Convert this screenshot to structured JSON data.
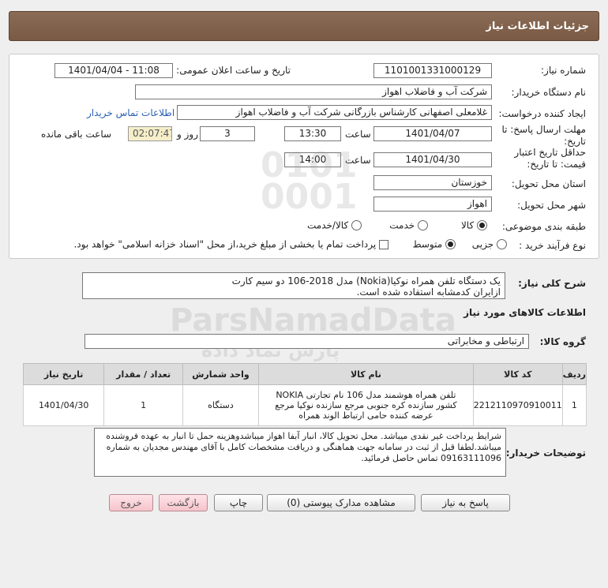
{
  "header": {
    "title": "جزئيات اطلاعات نياز"
  },
  "form": {
    "need_number_label": "شماره نیاز:",
    "need_number": "1101001331000129",
    "announce_label": "تاریخ و ساعت اعلان عمومی:",
    "announce_value": "1401/04/04 - 11:08",
    "buyer_label": "نام دستگاه خریدار:",
    "buyer_value": "شرکت آب و فاضلاب اهواز",
    "creator_label": "ایجاد کننده درخواست:",
    "creator_value": "غلامعلی اصفهانی کارشناس بازرگانی شرکت آب و فاضلاب اهواز",
    "contact_link": "اطلاعات تماس خریدار",
    "deadline_label": "مهلت ارسال پاسخ: تا تاریخ:",
    "deadline_date": "1401/04/07",
    "time_label": "ساعت",
    "deadline_time": "13:30",
    "days_value": "3",
    "days_label": "روز و",
    "remaining_time": "02:07:47",
    "remaining_label": "ساعت باقی مانده",
    "validity_label": "حداقل تاریخ اعتبار قیمت: تا تاریخ:",
    "validity_date": "1401/04/30",
    "validity_time_label": "ساعت",
    "validity_time": "14:00",
    "province_label": "استان محل تحویل:",
    "province_value": "خوزستان",
    "city_label": "شهر محل تحویل:",
    "city_value": "اهواز",
    "category_label": "طبقه بندی موضوعی:",
    "category_options": [
      "کالا",
      "خدمت",
      "کالا/خدمت"
    ],
    "category_selected": "کالا",
    "process_label": "نوع فرآیند خرید :",
    "process_options": [
      "جزیی",
      "متوسط"
    ],
    "process_selected": "متوسط",
    "payment_text": "پرداخت تمام یا بخشی از مبلغ خرید،از محل \"اسناد خزانه اسلامی\" خواهد بود."
  },
  "description": {
    "label": "شرح کلی نیاز:",
    "line1": "یک دستگاه تلفن همراه نوکیا(Nokia) مدل 2018-106 دو سیم کارت",
    "line2": "ازایران کدمشابه استفاده شده است."
  },
  "goods_info_label": "اطلاعات کالاهای مورد نیاز",
  "goods_group": {
    "label": "گروه کالا:",
    "value": "ارتباطی و مخابراتی"
  },
  "table": {
    "headers": [
      "ردیف",
      "کد کالا",
      "نام کالا",
      "واحد شمارش",
      "تعداد / مقدار",
      "تاریخ نیاز"
    ],
    "rows": [
      {
        "row": "1",
        "code": "2212110970910011",
        "name": "تلفن همراه هوشمند مدل 106 نام تجارتی NOKIA کشور سازنده کره جنوبی مرجع سازنده نوکیا مرجع عرضه کننده حامی ارتباط الوند همراه",
        "unit": "دستگاه",
        "qty": "1",
        "date": "1401/04/30"
      }
    ]
  },
  "buyer_notes": {
    "label": "توضیحات خریدار:",
    "text": "شرایط پرداخت غیر نقدی میباشد. محل تحویل کالا، انبار آبفا اهواز میباشدوهزینه حمل تا انبار به عهده فروشنده میباشد.لطفا قبل از ثبت در سامانه جهت هماهنگی و دریافت مشخصات کامل با آقای مهندس مجدیان به شماره 09163111096 تماس حاصل فرمائید."
  },
  "buttons": {
    "respond": "پاسخ به نیاز",
    "attachments": "مشاهده مدارک پیوستی (0)",
    "print": "چاپ",
    "back": "بازگشت",
    "exit": "خروج"
  },
  "watermark": {
    "brand": "ParsNamadData",
    "persian": "پارس نماد داده"
  }
}
